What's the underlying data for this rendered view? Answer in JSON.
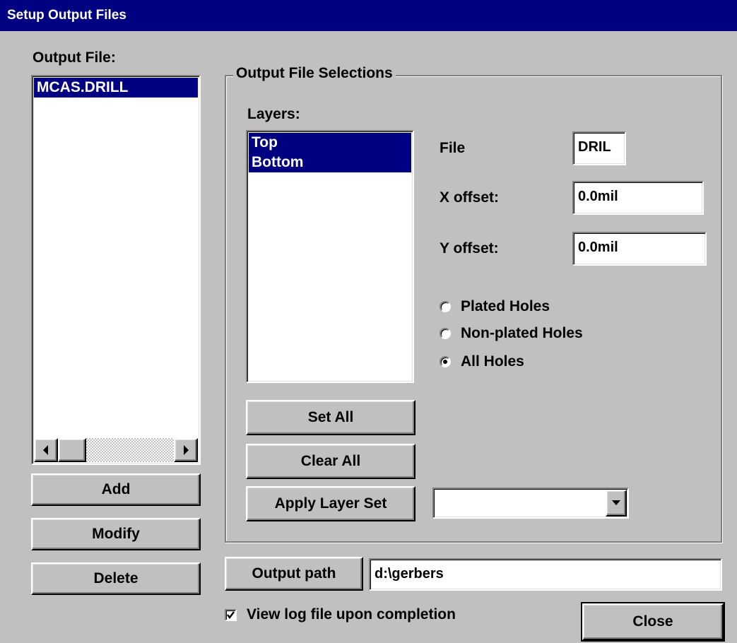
{
  "window": {
    "title": "Setup Output Files"
  },
  "left": {
    "label": "Output File:",
    "files": [
      "MCAS.DRILL"
    ],
    "add_label": "Add",
    "modify_label": "Modify",
    "delete_label": "Delete"
  },
  "group": {
    "title": "Output File Selections",
    "layers_label": "Layers:",
    "layers": [
      "Top",
      "Bottom"
    ],
    "set_all_label": "Set All",
    "clear_all_label": "Clear All",
    "apply_layer_set_label": "Apply Layer Set",
    "layer_set_value": "",
    "file_label": "File",
    "file_value": "DRIL",
    "x_offset_label": "X offset:",
    "x_offset_value": "0.0mil",
    "y_offset_label": "Y offset:",
    "y_offset_value": "0.0mil",
    "holes": [
      {
        "label": "Plated Holes",
        "selected": false
      },
      {
        "label": "Non-plated Holes",
        "selected": false
      },
      {
        "label": "All Holes",
        "selected": true
      }
    ]
  },
  "output_path_label": "Output path",
  "output_path_value": "d:\\gerbers",
  "view_log_label": "View log file upon completion",
  "view_log_checked": true,
  "close_label": "Close",
  "colors": {
    "titlebar": "#000080",
    "face": "#c0c0c0",
    "selection": "#000080"
  }
}
